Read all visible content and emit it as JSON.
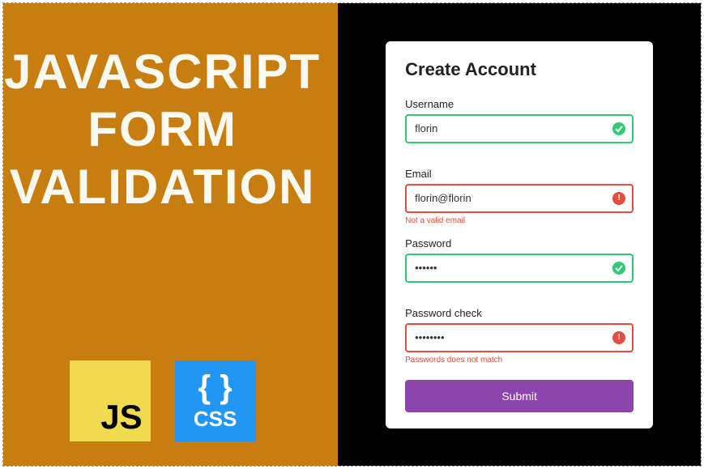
{
  "left": {
    "title_lines": [
      "JAVASCRIPT",
      "FORM",
      "VALIDATION"
    ],
    "js_logo_text": "JS",
    "css_logo_braces": "{ }",
    "css_logo_text": "CSS"
  },
  "form": {
    "title": "Create Account",
    "fields": [
      {
        "key": "username",
        "label": "Username",
        "value": "florin",
        "type": "text",
        "status": "success",
        "error": ""
      },
      {
        "key": "email",
        "label": "Email",
        "value": "florin@florin",
        "type": "text",
        "status": "error",
        "error": "Not a valid email"
      },
      {
        "key": "password",
        "label": "Password",
        "value": "••••••",
        "type": "text",
        "status": "success",
        "error": ""
      },
      {
        "key": "password_check",
        "label": "Password check",
        "value": "••••••••",
        "type": "text",
        "status": "error",
        "error": "Passwords does not match"
      }
    ],
    "submit_label": "Submit"
  }
}
